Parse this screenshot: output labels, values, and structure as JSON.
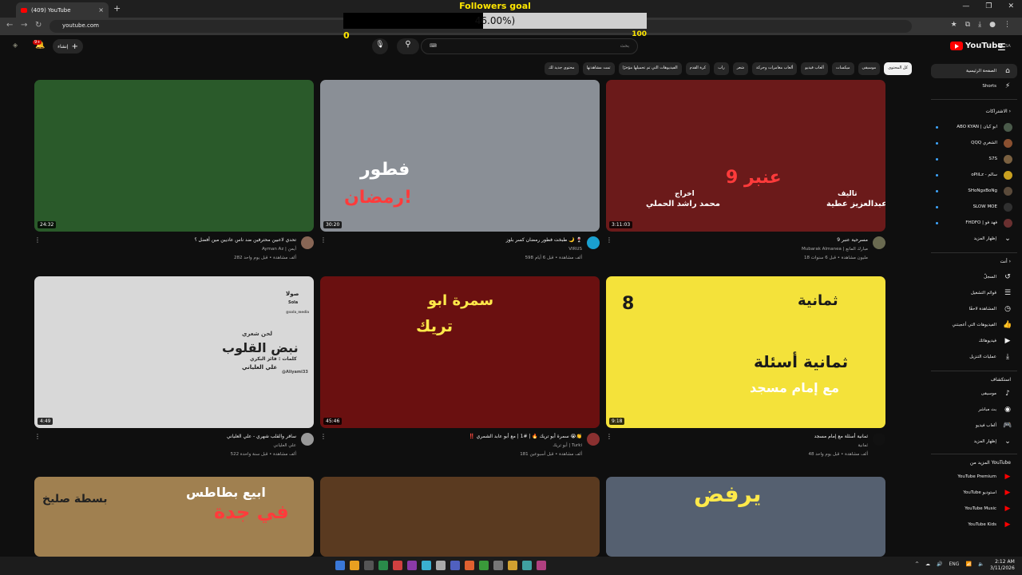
{
  "browser": {
    "tab_title": "(409) YouTube",
    "tab_close": "×",
    "new_tab": "+",
    "url": "youtube.com",
    "window_controls": [
      "—",
      "❐",
      "✕"
    ]
  },
  "followers_goal": {
    "title": "Followers goal",
    "progress_text": "46.00%)",
    "progress_fraction": 0.46,
    "min": "0",
    "max": "100"
  },
  "header": {
    "logo_text": "YouTube",
    "logo_region": "SA",
    "search_placeholder": "بحث",
    "search_keyboard_icon": "⌨",
    "create_label": "إنشاء",
    "notification_count": "9+"
  },
  "chips": [
    {
      "label": "كل المحتوى",
      "active": true
    },
    {
      "label": "موسيقى"
    },
    {
      "label": "ميكسات"
    },
    {
      "label": "ألعاب فيديو"
    },
    {
      "label": "ألعاب مغامرات وحركة"
    },
    {
      "label": "شعر"
    },
    {
      "label": "راب"
    },
    {
      "label": "كرة القدم"
    },
    {
      "label": "الفيديوهات التي تم تحميلها مؤخرًا"
    },
    {
      "label": "تمت مشاهدتها"
    },
    {
      "label": "محتوى جديد لك"
    }
  ],
  "sidebar": {
    "home": "الصفحة الرئيسية",
    "shorts": "Shorts",
    "subscriptions_header": "الاشتراكات",
    "subscriptions": [
      {
        "name": "ABO KYAN | ابو كيان",
        "color": "#4a5a4a"
      },
      {
        "name": "QQQ الشغري",
        "color": "#8a5030"
      },
      {
        "name": "S7S",
        "color": "#7a6040"
      },
      {
        "name": "oPiiLz - سالم",
        "color": "#c9a020"
      },
      {
        "name": "SHoNgxBoNg",
        "color": "#5a4a3a"
      },
      {
        "name": "SLOW MOE",
        "color": "#303030"
      },
      {
        "name": "FHDFO | فهد فو",
        "color": "#6a3030"
      }
    ],
    "show_more": "إظهار المزيد",
    "you_header": "أنت",
    "you_items": [
      "السجلّ",
      "قوائم التشغيل",
      "المشاهدة لاحقًا",
      "الفيديوهات التي أعجبتني",
      "فيديوهاتك",
      "عمليات التنزيل"
    ],
    "explore_header": "استكشاف",
    "explore_items": [
      "موسيقى",
      "بث مباشر",
      "ألعاب فيديو",
      "إظهار المزيد"
    ],
    "more_header": "المزيد من YouTube",
    "more_items": [
      "YouTube Premium",
      "YouTube استوديو",
      "YouTube Music",
      "YouTube Kids"
    ]
  },
  "videos": [
    {
      "title": "مسرحية عنبر 9",
      "channel": "Mubarak Almanea | مبارك المانع",
      "stats": "18 مليون مشاهدة • قبل 6 سنوات",
      "duration": "3:11:03",
      "overlay": [
        "تاليف",
        "عبدالعزيز عطية",
        "اخراج",
        "محمد راشد الحملي",
        "عنبر 9"
      ],
      "bg": "#6b1a1a",
      "av": "#6a6a50"
    },
    {
      "title": "طبخت فطور رمضان كسر بلوز 🌙 🍷",
      "channel": "VIRUS",
      "stats": "598 ألف مشاهدة • قبل 6 أيام",
      "duration": "30:20",
      "overlay": [
        "فطور",
        "رمضان!"
      ],
      "bg": "#8a8f96",
      "av": "#1aa0d0"
    },
    {
      "title": "تحدي لاعبين محترفين ضد ناس عاديين مين أفضل ؟",
      "channel": "Ayman Az | أيمن",
      "stats": "282 ألف مشاهدة • قبل يوم واحد",
      "duration": "24:32",
      "overlay": [],
      "bg": "#2a5a2a",
      "av": "#886655"
    },
    {
      "title": "ثمانية أسئلة مع إمام مسجد",
      "channel": "ثمانية",
      "stats": "48 ألف مشاهدة • قبل يوم واحد",
      "duration": "9:18",
      "overlay": [
        "ثمانية أسئلة",
        "مع إمام مسجد",
        "ثمانية",
        "8"
      ],
      "bg": "#f4e23a",
      "av": "#111111"
    },
    {
      "title": "‼️ سمرة أبو تريك 🔥 | #1 | مع أبو عابد الشمري 😭👏",
      "channel": "أبو تريك | Turki",
      "stats": "181 ألف مشاهدة • قبل أسبوعين",
      "duration": "45:46",
      "overlay": [
        "سمرة ابو",
        "تريك"
      ],
      "bg": "#6a1010",
      "av": "#8a3030"
    },
    {
      "title": "سافر والقلب شهري - علي العلياني",
      "channel": "علي العلياني",
      "stats": "522 ألف مشاهدة • قبل سنة واحدة",
      "duration": "4:49",
      "overlay": [
        "لحن شعري",
        "نبض القلوب",
        "كلمات : فائز البكري",
        "علي العلياني",
        "صولا",
        "Sola",
        "@sola_media",
        "@Aliyami33"
      ],
      "bg": "#d8d8d8",
      "av": "#999999"
    },
    {
      "title": "",
      "channel": "",
      "stats": "",
      "duration": "",
      "overlay": [
        "يرفض"
      ],
      "bg": "#556070",
      "av": "#333333"
    },
    {
      "title": "",
      "channel": "",
      "stats": "",
      "duration": "",
      "overlay": [],
      "bg": "#5a3a20",
      "av": "#333333"
    },
    {
      "title": "",
      "channel": "",
      "stats": "",
      "duration": "",
      "overlay": [
        "ابيع بطاطس",
        "في جدة",
        "بسطة صليخ"
      ],
      "bg": "#a08050",
      "av": "#333333"
    }
  ],
  "taskbar": {
    "tray": [
      "^",
      "☁",
      "🔊",
      "ENG",
      "📶",
      "🔈"
    ],
    "lang": "ENG",
    "time": "2:12 AM",
    "date": "3/11/2026"
  },
  "colors": {
    "accent_red": "#ff0000",
    "goal_yellow": "#ffe600",
    "bg": "#0f0f0f"
  }
}
